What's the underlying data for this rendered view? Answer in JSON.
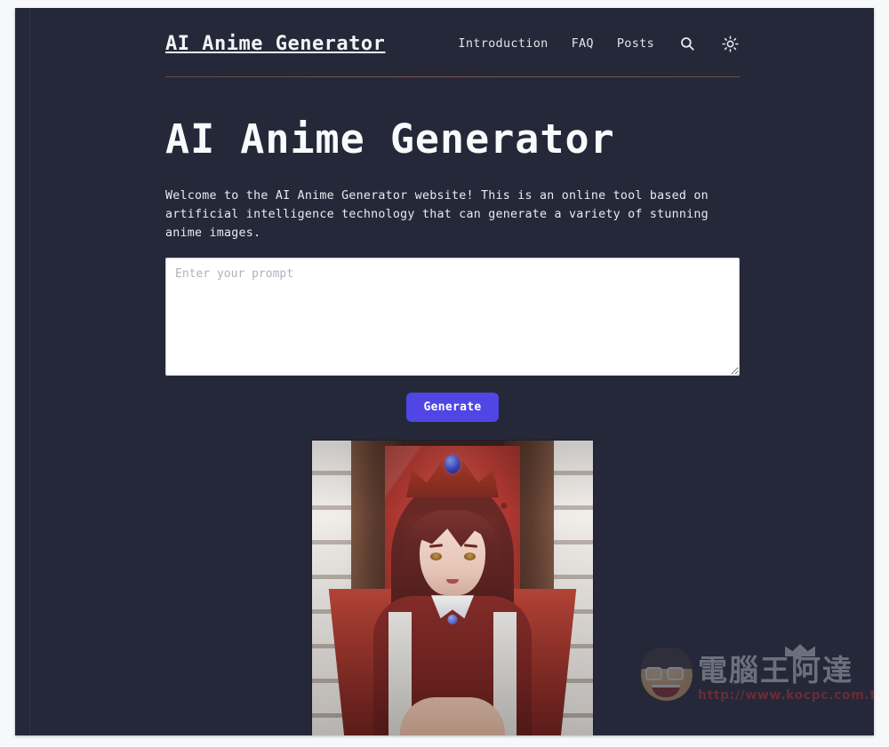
{
  "header": {
    "brand": "AI Anime Generator",
    "nav_links": [
      {
        "label": "Introduction"
      },
      {
        "label": "FAQ"
      },
      {
        "label": "Posts"
      }
    ],
    "search_icon": "search-icon",
    "theme_icon": "sun-icon"
  },
  "hero": {
    "title": "AI Anime Generator",
    "description": "Welcome to the AI Anime Generator website! This is an online tool based on artificial intelligence technology that can generate a variety of stunning anime images."
  },
  "prompt": {
    "placeholder": "Enter your prompt",
    "value": ""
  },
  "actions": {
    "generate_label": "Generate"
  },
  "result": {
    "alt": "Generated anime image of a red-haired girl wearing a crown seated on a red throne"
  },
  "watermark": {
    "brand_cjk": "電腦王阿達",
    "url": "http://www.kocpc.com.tw"
  },
  "colors": {
    "page_background": "#242839",
    "text_primary": "#f3f4f6",
    "accent_button": "#4f46e5",
    "divider": "#8a5a44",
    "watermark_url": "#c8322f"
  }
}
